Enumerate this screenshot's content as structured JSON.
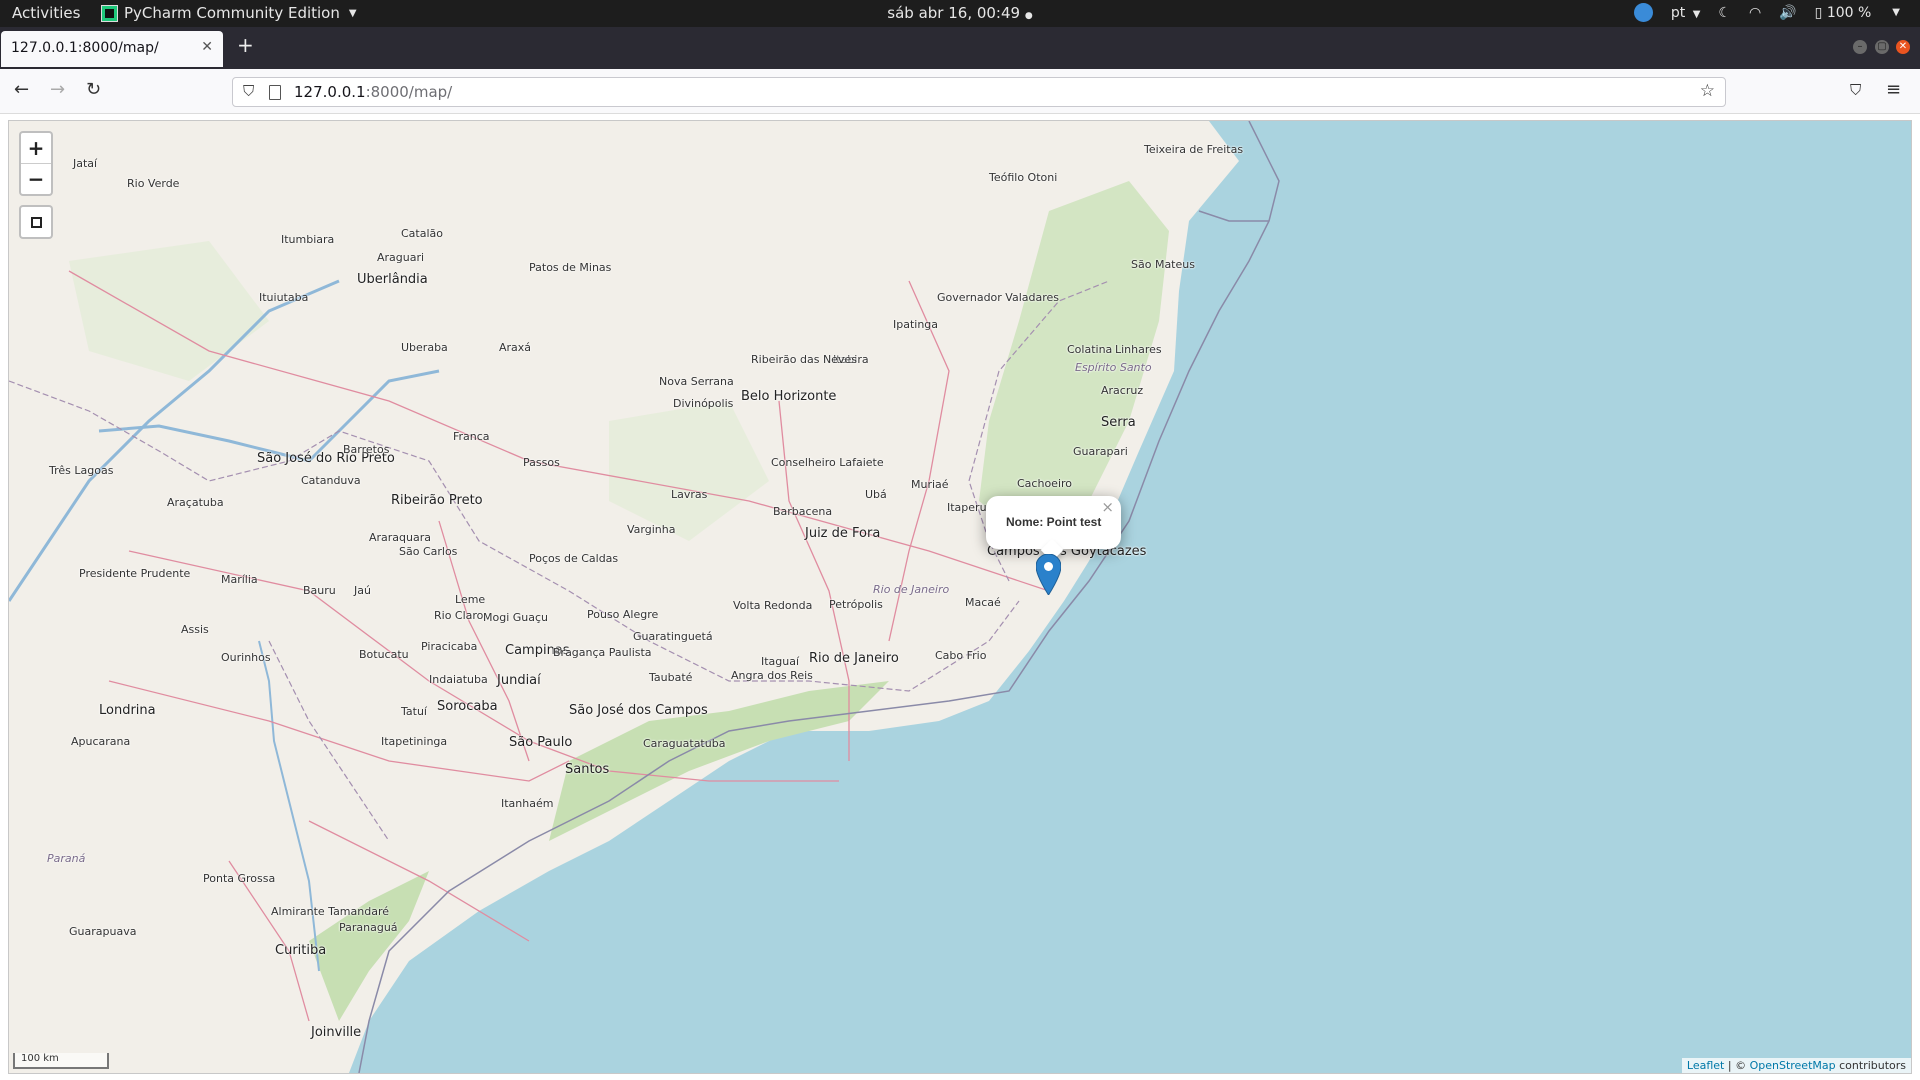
{
  "topbar": {
    "activities": "Activities",
    "app_name": "PyCharm Community Edition",
    "clock": "sáb abr 16, 00:49",
    "language": "pt",
    "battery": "100 %"
  },
  "browser": {
    "tab_title": "127.0.0.1:8000/map/",
    "url_host": "127.0.0.1",
    "url_rest": ":8000/map/"
  },
  "map": {
    "zoom_in": "+",
    "zoom_out": "−",
    "scale_label": "100 km",
    "attribution": {
      "leaflet": "Leaflet",
      "sep": " | © ",
      "osm": "OpenStreetMap",
      "suffix": " contributors"
    },
    "popup_text": "Nome: Point test",
    "popup_close": "×",
    "cities": [
      {
        "name": "Jataí",
        "cls": ""
      },
      {
        "name": "Rio Verde",
        "cls": ""
      },
      {
        "name": "Itumbiara",
        "cls": ""
      },
      {
        "name": "Catalão",
        "cls": ""
      },
      {
        "name": "Araguari",
        "cls": ""
      },
      {
        "name": "Uberlândia",
        "cls": "big"
      },
      {
        "name": "Patos de Minas",
        "cls": ""
      },
      {
        "name": "Ituiutaba",
        "cls": ""
      },
      {
        "name": "Uberaba",
        "cls": ""
      },
      {
        "name": "Araxá",
        "cls": ""
      },
      {
        "name": "Teófilo Otoni",
        "cls": ""
      },
      {
        "name": "Teixeira de Freitas",
        "cls": ""
      },
      {
        "name": "São Mateus",
        "cls": ""
      },
      {
        "name": "Governador Valadares",
        "cls": ""
      },
      {
        "name": "Ipatinga",
        "cls": ""
      },
      {
        "name": "Colatina",
        "cls": ""
      },
      {
        "name": "Linhares",
        "cls": ""
      },
      {
        "name": "Espírito Santo",
        "cls": "state"
      },
      {
        "name": "Aracruz",
        "cls": ""
      },
      {
        "name": "Serra",
        "cls": "big"
      },
      {
        "name": "Guarapari",
        "cls": ""
      },
      {
        "name": "Cachoeiro",
        "cls": ""
      },
      {
        "name": "Itabira",
        "cls": ""
      },
      {
        "name": "Ribeirão das Neves",
        "cls": ""
      },
      {
        "name": "Nova Serrana",
        "cls": ""
      },
      {
        "name": "Belo Horizonte",
        "cls": "big"
      },
      {
        "name": "Divinópolis",
        "cls": ""
      },
      {
        "name": "São José do Rio Preto",
        "cls": "big"
      },
      {
        "name": "Barretos",
        "cls": ""
      },
      {
        "name": "Franca",
        "cls": ""
      },
      {
        "name": "Passos",
        "cls": ""
      },
      {
        "name": "Três Lagoas",
        "cls": ""
      },
      {
        "name": "Catanduva",
        "cls": ""
      },
      {
        "name": "Araçatuba",
        "cls": ""
      },
      {
        "name": "Ribeirão Preto",
        "cls": "big"
      },
      {
        "name": "Conselheiro Lafaiete",
        "cls": ""
      },
      {
        "name": "Muriaé",
        "cls": ""
      },
      {
        "name": "Lavras",
        "cls": ""
      },
      {
        "name": "Barbacena",
        "cls": ""
      },
      {
        "name": "Ubá",
        "cls": ""
      },
      {
        "name": "Itaperuna",
        "cls": ""
      },
      {
        "name": "Araraquara",
        "cls": ""
      },
      {
        "name": "Varginha",
        "cls": ""
      },
      {
        "name": "Juiz de Fora",
        "cls": "big"
      },
      {
        "name": "São Carlos",
        "cls": ""
      },
      {
        "name": "Poços de Caldas",
        "cls": ""
      },
      {
        "name": "Campos dos Goytacazes",
        "cls": "big"
      },
      {
        "name": "Presidente Prudente",
        "cls": ""
      },
      {
        "name": "Marília",
        "cls": ""
      },
      {
        "name": "Bauru",
        "cls": ""
      },
      {
        "name": "Jaú",
        "cls": ""
      },
      {
        "name": "Leme",
        "cls": ""
      },
      {
        "name": "Rio Claro",
        "cls": ""
      },
      {
        "name": "Mogi Guaçu",
        "cls": ""
      },
      {
        "name": "Pouso Alegre",
        "cls": ""
      },
      {
        "name": "Rio de Janeiro",
        "cls": "state"
      },
      {
        "name": "Volta Redonda",
        "cls": ""
      },
      {
        "name": "Petrópolis",
        "cls": ""
      },
      {
        "name": "Macaé",
        "cls": ""
      },
      {
        "name": "Assis",
        "cls": ""
      },
      {
        "name": "Piracicaba",
        "cls": ""
      },
      {
        "name": "Guaratinguetá",
        "cls": ""
      },
      {
        "name": "Ourinhos",
        "cls": ""
      },
      {
        "name": "Botucatu",
        "cls": ""
      },
      {
        "name": "Campinas",
        "cls": "big"
      },
      {
        "name": "Bragança Paulista",
        "cls": ""
      },
      {
        "name": "Itaguaí",
        "cls": ""
      },
      {
        "name": "Rio de Janeiro",
        "cls": "big"
      },
      {
        "name": "Cabo Frio",
        "cls": ""
      },
      {
        "name": "Indaiatuba",
        "cls": ""
      },
      {
        "name": "Jundiaí",
        "cls": "big"
      },
      {
        "name": "Taubaté",
        "cls": ""
      },
      {
        "name": "Angra dos Reis",
        "cls": ""
      },
      {
        "name": "Londrina",
        "cls": "big"
      },
      {
        "name": "Tatuí",
        "cls": ""
      },
      {
        "name": "Sorocaba",
        "cls": "big"
      },
      {
        "name": "São José dos Campos",
        "cls": "big"
      },
      {
        "name": "Apucarana",
        "cls": ""
      },
      {
        "name": "Itapetininga",
        "cls": ""
      },
      {
        "name": "São Paulo",
        "cls": "big"
      },
      {
        "name": "Caraguatatuba",
        "cls": ""
      },
      {
        "name": "Santos",
        "cls": "big"
      },
      {
        "name": "Itanhaém",
        "cls": ""
      },
      {
        "name": "Paraná",
        "cls": "state"
      },
      {
        "name": "Ponta Grossa",
        "cls": ""
      },
      {
        "name": "Almirante Tamandaré",
        "cls": ""
      },
      {
        "name": "Guarapuava",
        "cls": ""
      },
      {
        "name": "Paranaguá",
        "cls": ""
      },
      {
        "name": "Curitiba",
        "cls": "big"
      },
      {
        "name": "Joinville",
        "cls": "big"
      }
    ]
  }
}
